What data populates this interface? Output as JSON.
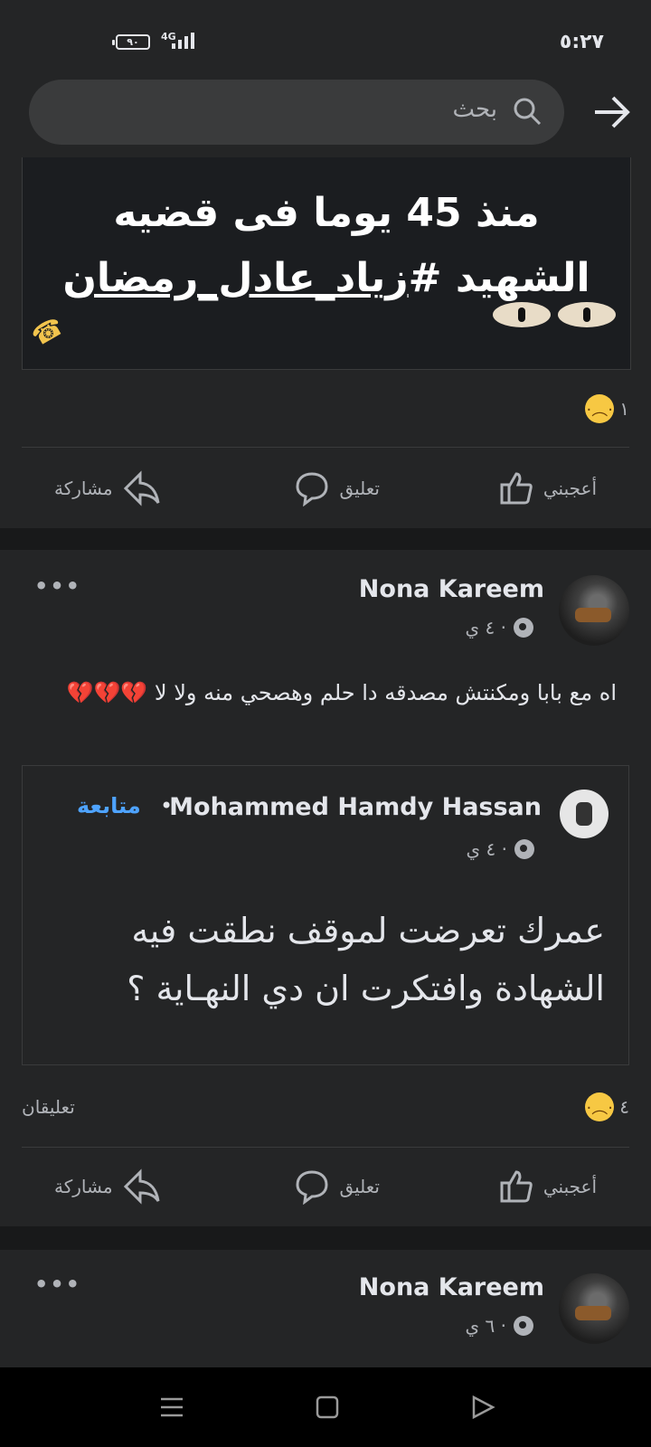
{
  "status": {
    "battery": "٩٠",
    "network": "4G",
    "time": "٥:٢٧"
  },
  "search": {
    "placeholder": "بحث"
  },
  "post1": {
    "image_text_line1": "منذ 45 يوما  فى قضيه",
    "image_text_line2_prefix": "الشهيد #",
    "image_text_line2_link": "زياد_عادل_رمضان",
    "reaction_count": "١",
    "actions": {
      "like": "أعجبني",
      "comment": "تعليق",
      "share": "مشاركة"
    }
  },
  "post2": {
    "author": "Nona Kareem",
    "time": "٤ ي ·",
    "text": "اه مع بابا ومكنتش مصدقه دا حلم وهصحي منه ولا لا 💔💔💔",
    "shared": {
      "author": "Mohammed Hamdy Hassan",
      "follow_label": "متابعة",
      "time": "٤ ي ·",
      "text": "عمرك تعرضت لموقف نطقت فيه الشهادة وافتكرت ان دي النهـاية ؟"
    },
    "reaction_count": "٤",
    "comments_label": "تعليقان",
    "actions": {
      "like": "أعجبني",
      "comment": "تعليق",
      "share": "مشاركة"
    }
  },
  "post3": {
    "author": "Nona Kareem",
    "time": "٦ ي ·"
  },
  "colors": {
    "background": "#18191a",
    "card": "#242526",
    "link": "#4ea3ff",
    "heart": "#e63b4a"
  }
}
